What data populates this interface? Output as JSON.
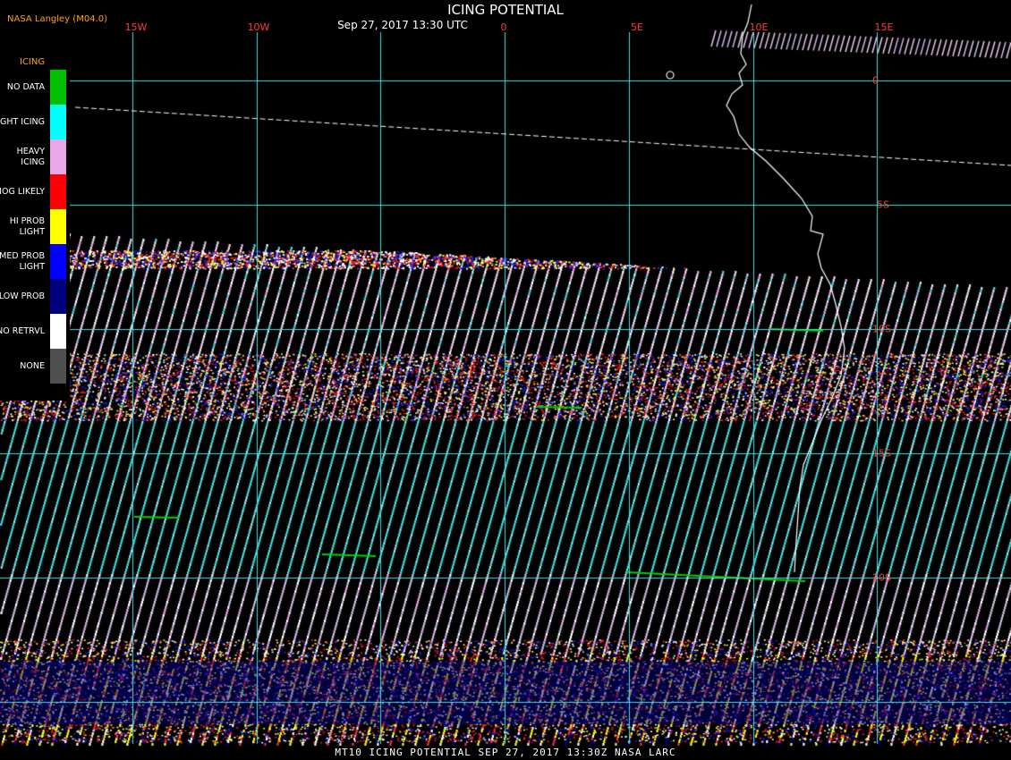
{
  "header": {
    "source": "NASA Langley (M04.0)",
    "title": "ICING POTENTIAL",
    "datetime": "Sep 27, 2017 13:30 UTC"
  },
  "footer": {
    "caption": "MT10  ICING POTENTIAL  SEP 27, 2017 13:30Z  NASA LARC"
  },
  "legend": {
    "title": "ICING",
    "items": [
      {
        "label": "NO DATA",
        "color": "#00c000"
      },
      {
        "label": "NIGHT ICING",
        "color": "#00ffff"
      },
      {
        "label": "HEAVY ICING",
        "color": "#e8a8e8"
      },
      {
        "label": "MOG LIKELY",
        "color": "#ff0000"
      },
      {
        "label": "HI PROB LIGHT",
        "color": "#ffff00"
      },
      {
        "label": "MED PROB LIGHT",
        "color": "#0000ff"
      },
      {
        "label": "LOW PROB",
        "color": "#000080"
      },
      {
        "label": "NO RETRVL",
        "color": "#ffffff"
      },
      {
        "label": "NONE",
        "color": "#505050"
      }
    ]
  },
  "map": {
    "longitude_labels": [
      "15W",
      "10W",
      "0",
      "5E",
      "10E",
      "15E"
    ],
    "latitude_labels": [
      "0",
      "5S",
      "10S",
      "15S",
      "20S"
    ],
    "gridline_color": "#40e0e0",
    "coastline_color": "#ffffff"
  }
}
